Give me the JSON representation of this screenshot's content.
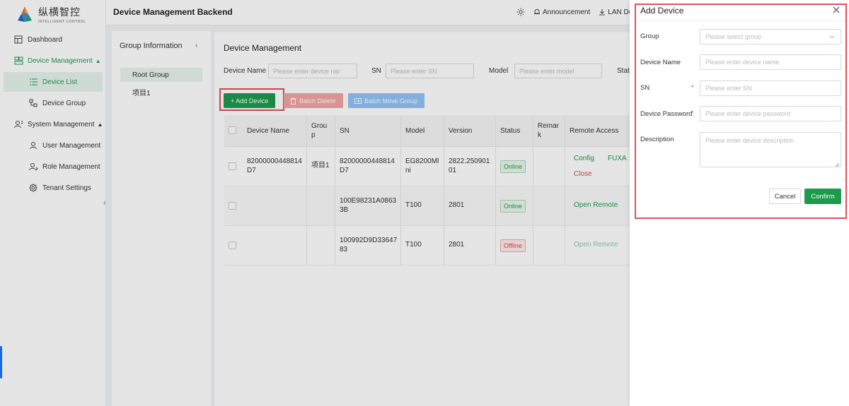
{
  "brand": {
    "name_cn": "纵横智控",
    "name_en": "INTELLIGENT CONTROL"
  },
  "sidebar": {
    "items": [
      {
        "label": "Dashboard"
      },
      {
        "label": "Device Management"
      },
      {
        "label": "Device List"
      },
      {
        "label": "Device Group"
      },
      {
        "label": "System Management"
      },
      {
        "label": "User Management"
      },
      {
        "label": "Role Management"
      },
      {
        "label": "Tenant Settings"
      }
    ]
  },
  "header": {
    "title": "Device Management Backend",
    "announcement": "Announcement",
    "lan_download": "LAN Dow"
  },
  "group_panel": {
    "title": "Group Information",
    "root": "Root Group",
    "items": [
      "项目1"
    ]
  },
  "main": {
    "title": "Device Management",
    "filters": {
      "device_name_label": "Device Name",
      "device_name_placeholder": "Please enter device nar",
      "sn_label": "SN",
      "sn_placeholder": "Please enter SN",
      "model_label": "Model",
      "model_placeholder": "Please enter model",
      "status_label": "Stat"
    },
    "toolbar": {
      "add": "+ Add Device",
      "batch_delete": "Batch Delete",
      "batch_move": "Batch Move Group"
    },
    "table": {
      "headers": {
        "device_name": "Device Name",
        "group_1": "Grou",
        "group_2": "p",
        "sn": "SN",
        "model": "Model",
        "version": "Version",
        "status": "Status",
        "remark_1": "Remar",
        "remark_2": "k",
        "remote": "Remote Access"
      },
      "rows": [
        {
          "name_1": "82000000448814",
          "name_2": "D7",
          "group": "项目1",
          "sn_1": "82000000448814",
          "sn_2": "D7",
          "model_1": "EG8200Ml",
          "model_2": "ni",
          "version_1": "2822.250901",
          "version_2": "01",
          "status": "Online",
          "actions": [
            "Config",
            "FUXA",
            "Close"
          ]
        },
        {
          "name_1": "",
          "name_2": "",
          "group": "",
          "sn_1": "100E98231A0863",
          "sn_2": "3B",
          "model_1": "T100",
          "model_2": "",
          "version_1": "2801",
          "version_2": "",
          "status": "Online",
          "actions": [
            "Open Remote"
          ]
        },
        {
          "name_1": "",
          "name_2": "",
          "group": "",
          "sn_1": "100992D9D33647",
          "sn_2": "83",
          "model_1": "T100",
          "model_2": "",
          "version_1": "2801",
          "version_2": "",
          "status": "Offline",
          "actions": [
            "Open Remote"
          ]
        }
      ]
    }
  },
  "drawer": {
    "title": "Add Device",
    "fields": {
      "group": {
        "label": "Group",
        "placeholder": "Please select group"
      },
      "device_name": {
        "label": "Device Name",
        "placeholder": "Please enter device name"
      },
      "sn": {
        "label": "SN",
        "placeholder": "Please enter SN"
      },
      "password": {
        "label": "Device Password",
        "placeholder": "Please enter device password"
      },
      "description": {
        "label": "Description",
        "placeholder": "Please enter device description"
      }
    },
    "required_mark": "*",
    "cancel": "Cancel",
    "confirm": "Confirm"
  },
  "colors": {
    "accent": "#1e9a4e",
    "danger": "#e0484f",
    "highlight": "#e2505a",
    "info": "#91c3f5"
  }
}
